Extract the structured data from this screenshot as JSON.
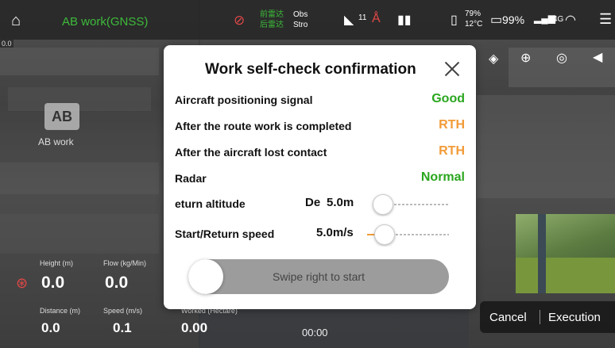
{
  "top_bar": {
    "mode_title": "AB work(GNSS)",
    "radar_front": "前雷达",
    "radar_front_status": "Obs",
    "radar_rear": "后雷达",
    "radar_rear_status": "Stro",
    "signal_count": "11",
    "battery_percent": "79%",
    "battery_temp": "12°C",
    "remote_battery": "99%",
    "network": "4G"
  },
  "speed_tag": "0.0",
  "left_panel": {
    "ab_button": "AB",
    "ab_label": "AB work"
  },
  "telemetry": {
    "height_label": "Height (m)",
    "height_value": "0.0",
    "flow_label": "Flow (kg/Min)",
    "flow_value": "0.0",
    "distance_label": "Distance (m)",
    "distance_value": "0.0",
    "speed_label": "Speed (m/s)",
    "speed_value": "0.1",
    "worked_label": "Worked (Hectare)",
    "worked_value": "0.00"
  },
  "timer": "00:00",
  "dialog": {
    "title": "Work self-check confirmation",
    "rows": [
      {
        "label": "Aircraft positioning signal",
        "value": "Good",
        "color": "#2aa61f"
      },
      {
        "label": "After the route work is completed",
        "value": "RTH",
        "color": "#f29b38"
      },
      {
        "label": "After the aircraft lost contact",
        "value": "RTH",
        "color": "#f29b38"
      },
      {
        "label": "Radar",
        "value": "Normal",
        "color": "#2aa61f"
      }
    ],
    "return_altitude": {
      "label": "eturn altitude",
      "prefix": "De",
      "value": "5.0m",
      "level": 0.0
    },
    "return_speed": {
      "label": "Start/Return speed",
      "value": "5.0m/s",
      "level": 0.15
    },
    "swipe_text": "Swipe right to start"
  },
  "actions": {
    "cancel": "Cancel",
    "execute": "Execution"
  },
  "colors": {
    "accent": "#f29b38",
    "good": "#2aa61f"
  }
}
